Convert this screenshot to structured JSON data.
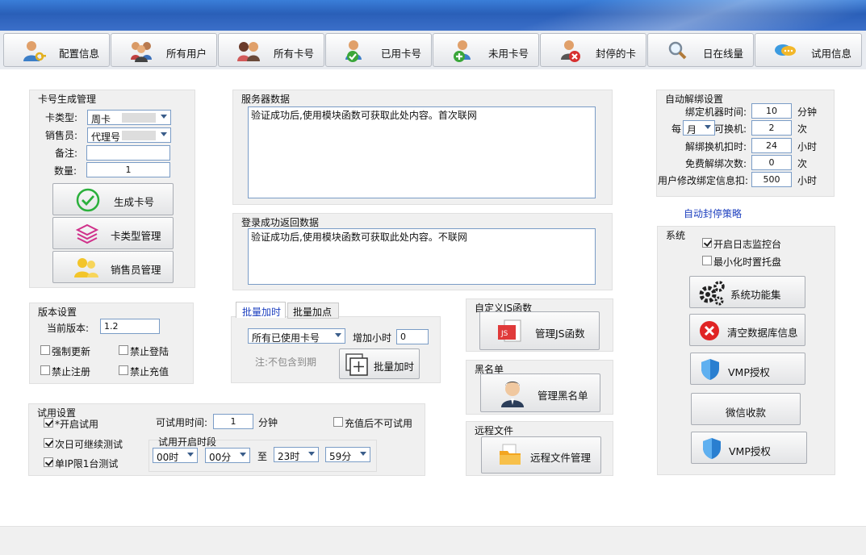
{
  "toolbar": [
    {
      "id": "config",
      "label": "配置信息",
      "icon": "user-key-icon"
    },
    {
      "id": "users",
      "label": "所有用户",
      "icon": "users-group-icon"
    },
    {
      "id": "cards",
      "label": "所有卡号",
      "icon": "users-pair-icon"
    },
    {
      "id": "used",
      "label": "已用卡号",
      "icon": "user-check-icon"
    },
    {
      "id": "unused",
      "label": "未用卡号",
      "icon": "user-add-icon"
    },
    {
      "id": "banned",
      "label": "封停的卡",
      "icon": "user-remove-icon"
    },
    {
      "id": "online",
      "label": "日在线量",
      "icon": "magnifier-icon"
    },
    {
      "id": "trial",
      "label": "试用信息",
      "icon": "chat-bubbles-icon"
    }
  ],
  "cardgen": {
    "title": "卡号生成管理",
    "type_label": "卡类型:",
    "type_value": "周卡",
    "seller_label": "销售员:",
    "seller_value": "代理号",
    "note_label": "备注:",
    "note_value": "",
    "qty_label": "数量:",
    "qty_value": "1",
    "gen_btn": "生成卡号",
    "type_mgr_btn": "卡类型管理",
    "seller_mgr_btn": "销售员管理"
  },
  "version": {
    "title": "版本设置",
    "current_label": "当前版本:",
    "current_value": "1.2",
    "force_update": "强制更新",
    "ban_login": "禁止登陆",
    "ban_register": "禁止注册",
    "ban_recharge": "禁止充值"
  },
  "trial": {
    "title": "试用设置",
    "enable": "*开启试用",
    "next_day": "次日可继续测试",
    "single_ip": "单IP限1台测试",
    "time_label": "可试用时间:",
    "time_value": "1",
    "time_unit": "分钟",
    "no_trial_after": "充值后不可试用",
    "period_label": "试用开启时段",
    "from_h": "00时",
    "from_m": "00分",
    "to_label": "至",
    "to_h": "23时",
    "to_m": "59分"
  },
  "server": {
    "title": "服务器数据",
    "text": "验证成功后,使用模块函数可获取此处内容。首次联网",
    "login_title": "登录成功返回数据",
    "login_text": "验证成功后,使用模块函数可获取此处内容。不联网"
  },
  "batch": {
    "tab1": "批量加时",
    "tab2": "批量加点",
    "select_value": "所有已使用卡号",
    "hours_label": "增加小时",
    "hours_value": "0",
    "note": "注:不包含到期",
    "btn": "批量加时"
  },
  "js": {
    "title": "自定义JS函数",
    "btn": "管理JS函数"
  },
  "blacklist": {
    "title": "黑名单",
    "btn": "管理黑名单"
  },
  "remote": {
    "title": "远程文件",
    "btn": "远程文件管理"
  },
  "unbind": {
    "title": "自动解绑设置",
    "bind_time_label": "绑定机器时间:",
    "bind_time_value": "10",
    "bind_time_unit": "分钟",
    "every_label": "每",
    "every_value": "月",
    "change_label": "可换机:",
    "change_value": "2",
    "change_unit": "次",
    "deduct_label": "解绑换机扣时:",
    "deduct_value": "24",
    "deduct_unit": "小时",
    "free_label": "免费解绑次数:",
    "free_value": "0",
    "free_unit": "次",
    "modify_label": "用户修改绑定信息扣:",
    "modify_value": "500",
    "modify_unit": "小时"
  },
  "policy_link": "自动封停策略",
  "system": {
    "title": "系统",
    "log_console": "开启日志监控台",
    "minimize_tray": "最小化时置托盘",
    "func_btn": "系统功能集",
    "clear_btn": "清空数据库信息",
    "vmp_btn": "VMP授权",
    "wechat_btn": "微信收款",
    "vmp_btn2": "VMP授权"
  },
  "checkbox_state": {
    "force_update": false,
    "ban_login": false,
    "ban_register": false,
    "ban_recharge": false,
    "enable_trial": true,
    "next_day": true,
    "single_ip": true,
    "no_trial_after": false,
    "log_console": true,
    "minimize_tray": false
  }
}
